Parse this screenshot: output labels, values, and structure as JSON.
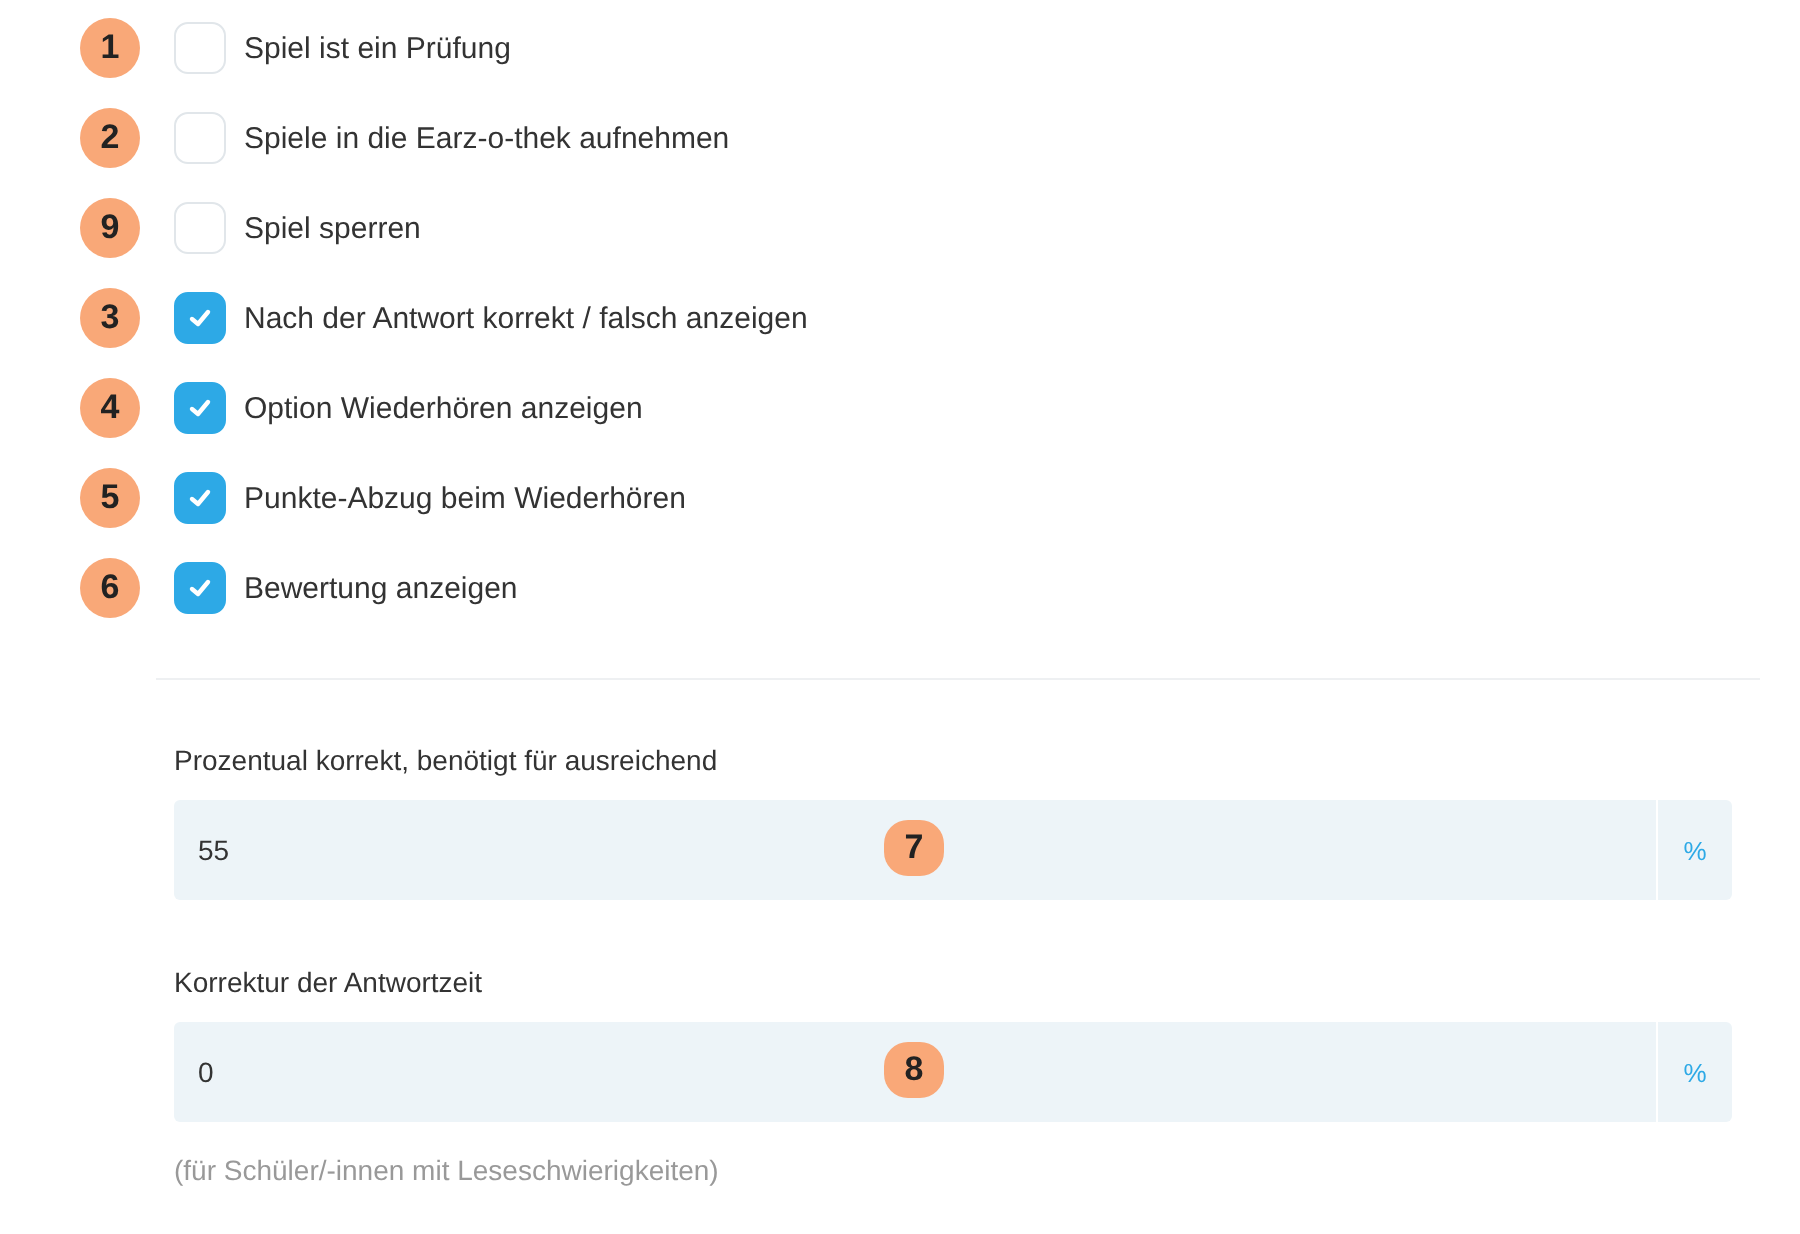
{
  "options": [
    {
      "badge": "1",
      "label": "Spiel ist ein Prüfung",
      "checked": false
    },
    {
      "badge": "2",
      "label": "Spiele in die Earz-o-thek aufnehmen",
      "checked": false
    },
    {
      "badge": "9",
      "label": "Spiel sperren",
      "checked": false
    },
    {
      "badge": "3",
      "label": "Nach der Antwort korrekt / falsch anzeigen",
      "checked": true
    },
    {
      "badge": "4",
      "label": "Option Wiederhören anzeigen",
      "checked": true
    },
    {
      "badge": "5",
      "label": "Punkte-Abzug beim Wiederhören",
      "checked": true
    },
    {
      "badge": "6",
      "label": "Bewertung anzeigen",
      "checked": true
    }
  ],
  "fields": [
    {
      "label": "Prozentual korrekt, benötigt für ausreichend",
      "value": "55",
      "badge": "7",
      "suffix": "%"
    },
    {
      "label": "Korrektur der Antwortzeit",
      "value": "0",
      "badge": "8",
      "suffix": "%",
      "hint": "(für Schüler/-innen mit Leseschwierigkeiten)"
    }
  ]
}
